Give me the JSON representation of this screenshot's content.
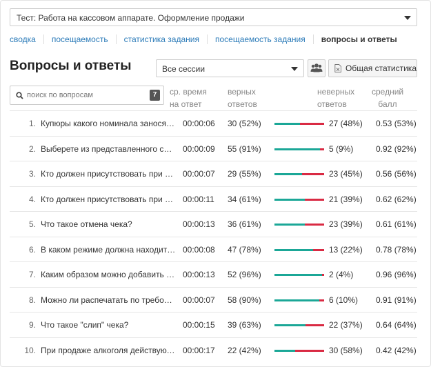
{
  "test_select": {
    "value": "Тест: Работа на кассовом аппарате. Оформление продажи"
  },
  "tabs": [
    {
      "label": "сводка"
    },
    {
      "label": "посещаемость"
    },
    {
      "label": "статистика задания"
    },
    {
      "label": "посещаемость задания"
    },
    {
      "label": "вопросы и ответы"
    }
  ],
  "page_title": "Вопросы и ответы",
  "session_select": {
    "value": "Все сессии"
  },
  "stats_button": {
    "label": "Общая статистика"
  },
  "search": {
    "placeholder": "поиск по вопросам",
    "count": "7"
  },
  "columns": {
    "avg_time": [
      "ср. время",
      "на ответ"
    ],
    "correct": [
      "верных",
      "ответов"
    ],
    "wrong": [
      "неверных",
      "ответов"
    ],
    "avg_score": [
      "средний",
      "балл"
    ]
  },
  "colors": {
    "correct_bar": "#1ba797",
    "wrong_bar": "#d92a43",
    "link": "#2a7ab8"
  },
  "rows": [
    {
      "num": "1.",
      "question": "Купюры какого номинала заносят в кассу…",
      "time": "00:00:06",
      "correct": "30 (52%)",
      "correct_pct": 52,
      "wrong": "27 (48%)",
      "score": "0.53 (53%)"
    },
    {
      "num": "2.",
      "question": "Выберете из представленного списка…",
      "time": "00:00:09",
      "correct": "55 (91%)",
      "correct_pct": 91,
      "wrong": "5 (9%)",
      "score": "0.92 (92%)"
    },
    {
      "num": "3.",
      "question": "Кто должен присутствовать при оформлении…",
      "time": "00:00:07",
      "correct": "29 (55%)",
      "correct_pct": 55,
      "wrong": "23 (45%)",
      "score": "0.56 (56%)"
    },
    {
      "num": "4.",
      "question": "Кто должен присутствовать при оформлении…",
      "time": "00:00:11",
      "correct": "34 (61%)",
      "correct_pct": 61,
      "wrong": "21 (39%)",
      "score": "0.62 (62%)"
    },
    {
      "num": "5.",
      "question": "Что такое отмена чека?",
      "time": "00:00:13",
      "correct": "36 (61%)",
      "correct_pct": 61,
      "wrong": "23 (39%)",
      "score": "0.61 (61%)"
    },
    {
      "num": "6.",
      "question": "В каком режиме должна находиться касса…",
      "time": "00:00:08",
      "correct": "47 (78%)",
      "correct_pct": 78,
      "wrong": "13 (22%)",
      "score": "0.78 (78%)"
    },
    {
      "num": "7.",
      "question": "Каким образом можно добавить позицию…",
      "time": "00:00:13",
      "correct": "52 (96%)",
      "correct_pct": 96,
      "wrong": "2 (4%)",
      "score": "0.96 (96%)"
    },
    {
      "num": "8.",
      "question": "Можно ли распечатать по требованию…",
      "time": "00:00:07",
      "correct": "58 (90%)",
      "correct_pct": 90,
      "wrong": "6 (10%)",
      "score": "0.91 (91%)"
    },
    {
      "num": "9.",
      "question": "Что такое \"слип\" чека?",
      "time": "00:00:15",
      "correct": "39 (63%)",
      "correct_pct": 63,
      "wrong": "22 (37%)",
      "score": "0.64 (64%)"
    },
    {
      "num": "10.",
      "question": "При продаже алкоголя действуют какие…",
      "time": "00:00:17",
      "correct": "22 (42%)",
      "correct_pct": 42,
      "wrong": "30 (58%)",
      "score": "0.42 (42%)"
    }
  ]
}
